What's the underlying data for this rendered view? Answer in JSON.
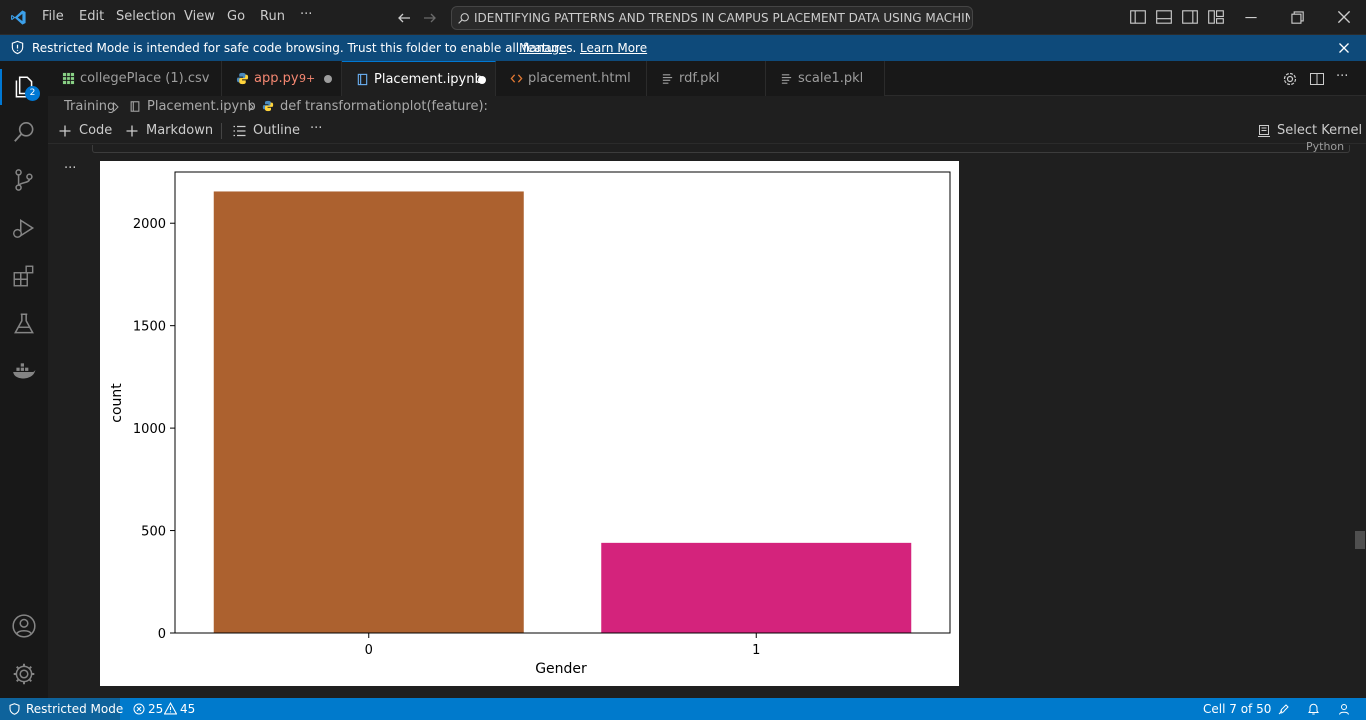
{
  "menu": {
    "file": "File",
    "edit": "Edit",
    "selection": "Selection",
    "view": "View",
    "go": "Go",
    "run": "Run",
    "more": "···"
  },
  "command_center": {
    "text": "IDENTIFYING PATTERNS AND TRENDS IN CAMPUS PLACEMENT DATA USING MACHINE LEAR..."
  },
  "banner": {
    "message": "Restricted Mode is intended for safe code browsing. Trust this folder to enable all features.",
    "manage": "Manage",
    "learn_more": "Learn More"
  },
  "activity_bar": {
    "explorer_badge": "2"
  },
  "tabs": [
    {
      "label": "collegePlace (1).csv",
      "icon": "csv-icon",
      "color": "#9d9d9d"
    },
    {
      "label": "app.py",
      "badge": "9+",
      "icon": "python-icon",
      "color": "#f48771"
    },
    {
      "label": "Placement.ipynb",
      "icon": "notebook-icon",
      "color": "#ffffff"
    },
    {
      "label": "placement.html",
      "icon": "html-icon",
      "color": "#9d9d9d"
    },
    {
      "label": "rdf.pkl",
      "icon": "file-lines-icon",
      "color": "#9d9d9d"
    },
    {
      "label": "scale1.pkl",
      "icon": "file-lines-icon",
      "color": "#9d9d9d"
    }
  ],
  "breadcrumb": {
    "folder": "Training",
    "file": "Placement.ipynb",
    "symbol": "def transformationplot(feature):"
  },
  "notebook_toolbar": {
    "code": "Code",
    "markdown": "Markdown",
    "outline": "Outline",
    "more": "···",
    "kernel": "Select Kernel"
  },
  "cell": {
    "more": "···",
    "language": "Python"
  },
  "chart_data": {
    "type": "bar",
    "categories": [
      "0",
      "1"
    ],
    "values": [
      2155,
      440
    ],
    "colors": [
      "#ac612f",
      "#d4237c"
    ],
    "xlabel": "Gender",
    "ylabel": "count",
    "ylim": [
      0,
      2250
    ],
    "yticks": [
      0,
      500,
      1000,
      1500,
      2000
    ],
    "grid": false
  },
  "status_bar": {
    "mode": "Restricted Mode",
    "errors": "25",
    "warnings": "45",
    "cell_position": "Cell 7 of 50"
  }
}
